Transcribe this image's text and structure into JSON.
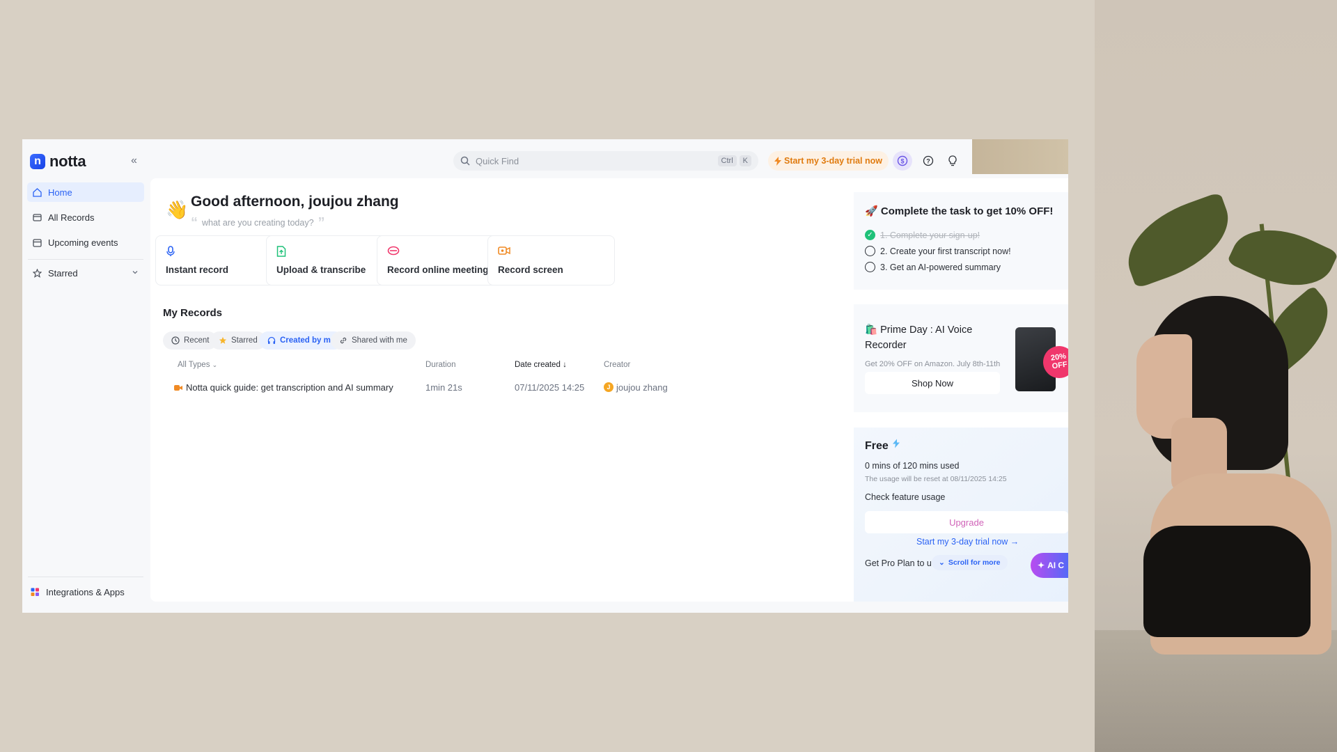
{
  "app": {
    "logo_letter": "n",
    "logo_text": "notta"
  },
  "topbar": {
    "search_placeholder": "Quick Find",
    "shortcut_ctrl": "Ctrl",
    "shortcut_key": "K",
    "trial_label": "Start my 3-day trial now"
  },
  "sidebar": {
    "items": [
      {
        "label": "Home",
        "icon": "home-icon"
      },
      {
        "label": "All Records",
        "icon": "records-icon"
      },
      {
        "label": "Upcoming events",
        "icon": "calendar-icon"
      },
      {
        "label": "Starred",
        "icon": "star-icon"
      }
    ],
    "integrations_label": "Integrations & Apps"
  },
  "main": {
    "greeting": "Good afternoon, joujou zhang",
    "subtitle": "what are you creating today?",
    "actions": [
      {
        "label": "Instant record",
        "icon": "microphone-icon",
        "color": "#2a62f4"
      },
      {
        "label": "Upload & transcribe",
        "icon": "upload-file-icon",
        "color": "#1fc179"
      },
      {
        "label": "Record online meeting",
        "icon": "meeting-icon",
        "color": "#f0376c"
      },
      {
        "label": "Record screen",
        "icon": "screen-record-icon",
        "color": "#f08a24"
      }
    ],
    "records_title": "My Records",
    "filters": [
      "Recent",
      "Starred",
      "Created by me",
      "Shared with me"
    ],
    "columns": {
      "type": "All Types",
      "duration": "Duration",
      "date": "Date created",
      "creator": "Creator"
    },
    "rows": [
      {
        "title": "Notta quick guide: get transcription and AI summary",
        "duration": "1min 21s",
        "date": "07/11/2025 14:25",
        "creator": "joujou zhang",
        "creator_initial": "J"
      }
    ]
  },
  "task_panel": {
    "title": "Complete the task to get 10% OFF!",
    "items": [
      {
        "label": "1. Complete your sign-up!",
        "done": true
      },
      {
        "label": "2. Create your first transcript now!",
        "done": false
      },
      {
        "label": "3. Get an AI-powered summary",
        "done": false
      }
    ]
  },
  "promo": {
    "title": "Prime Day : AI Voice Recorder",
    "subtitle": "Get 20% OFF on Amazon. July 8th-11th",
    "button": "Shop Now",
    "badge_line1": "20%",
    "badge_line2": "OFF"
  },
  "plan": {
    "name": "Free",
    "usage": "0 mins of 120 mins used",
    "reset": "The usage will be reset at 08/11/2025 14:25",
    "check": "Check feature usage",
    "upgrade": "Upgrade",
    "trial": "Start my 3-day trial now →",
    "pro": "Get Pro Plan to u",
    "scroll": "Scroll for more",
    "ai_label": "AI C"
  },
  "colors": {
    "accent": "#2a62f4",
    "trial": "#e07b0f",
    "upgrade": "#d063b8"
  }
}
